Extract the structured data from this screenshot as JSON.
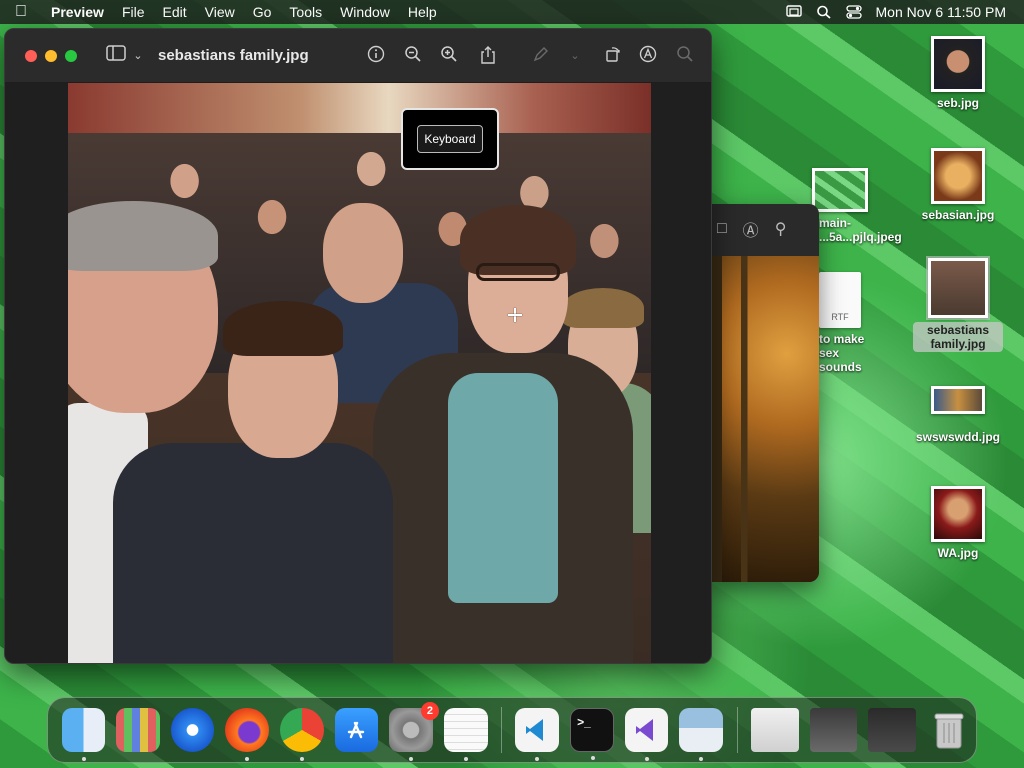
{
  "menubar": {
    "app": "Preview",
    "items": [
      "File",
      "Edit",
      "View",
      "Go",
      "Tools",
      "Window",
      "Help"
    ],
    "clock": "Mon Nov 6  11:50 PM"
  },
  "window": {
    "title": "sebastians family.jpg"
  },
  "popup": {
    "label": "Keyboard"
  },
  "desktop": {
    "icons": [
      {
        "label": "seb.jpg"
      },
      {
        "label": "sebasian.jpg"
      },
      {
        "label": "sebastians family.jpg"
      },
      {
        "label": "swswswdd.jpg"
      },
      {
        "label": "WA.jpg"
      },
      {
        "label": "main-\n...5a...pjlq.jpeg"
      },
      {
        "label": "to make sex\nsounds"
      }
    ],
    "rtf_tag": "RTF"
  },
  "dock": {
    "apps": [
      "Finder",
      "Launchpad",
      "Safari",
      "Firefox",
      "Chrome",
      "App Store",
      "System Settings",
      "TextEdit",
      "VS Code",
      "Terminal",
      "Visual Studio",
      "Preview"
    ],
    "settings_badge": "2",
    "terminal_glyph": ">_"
  }
}
